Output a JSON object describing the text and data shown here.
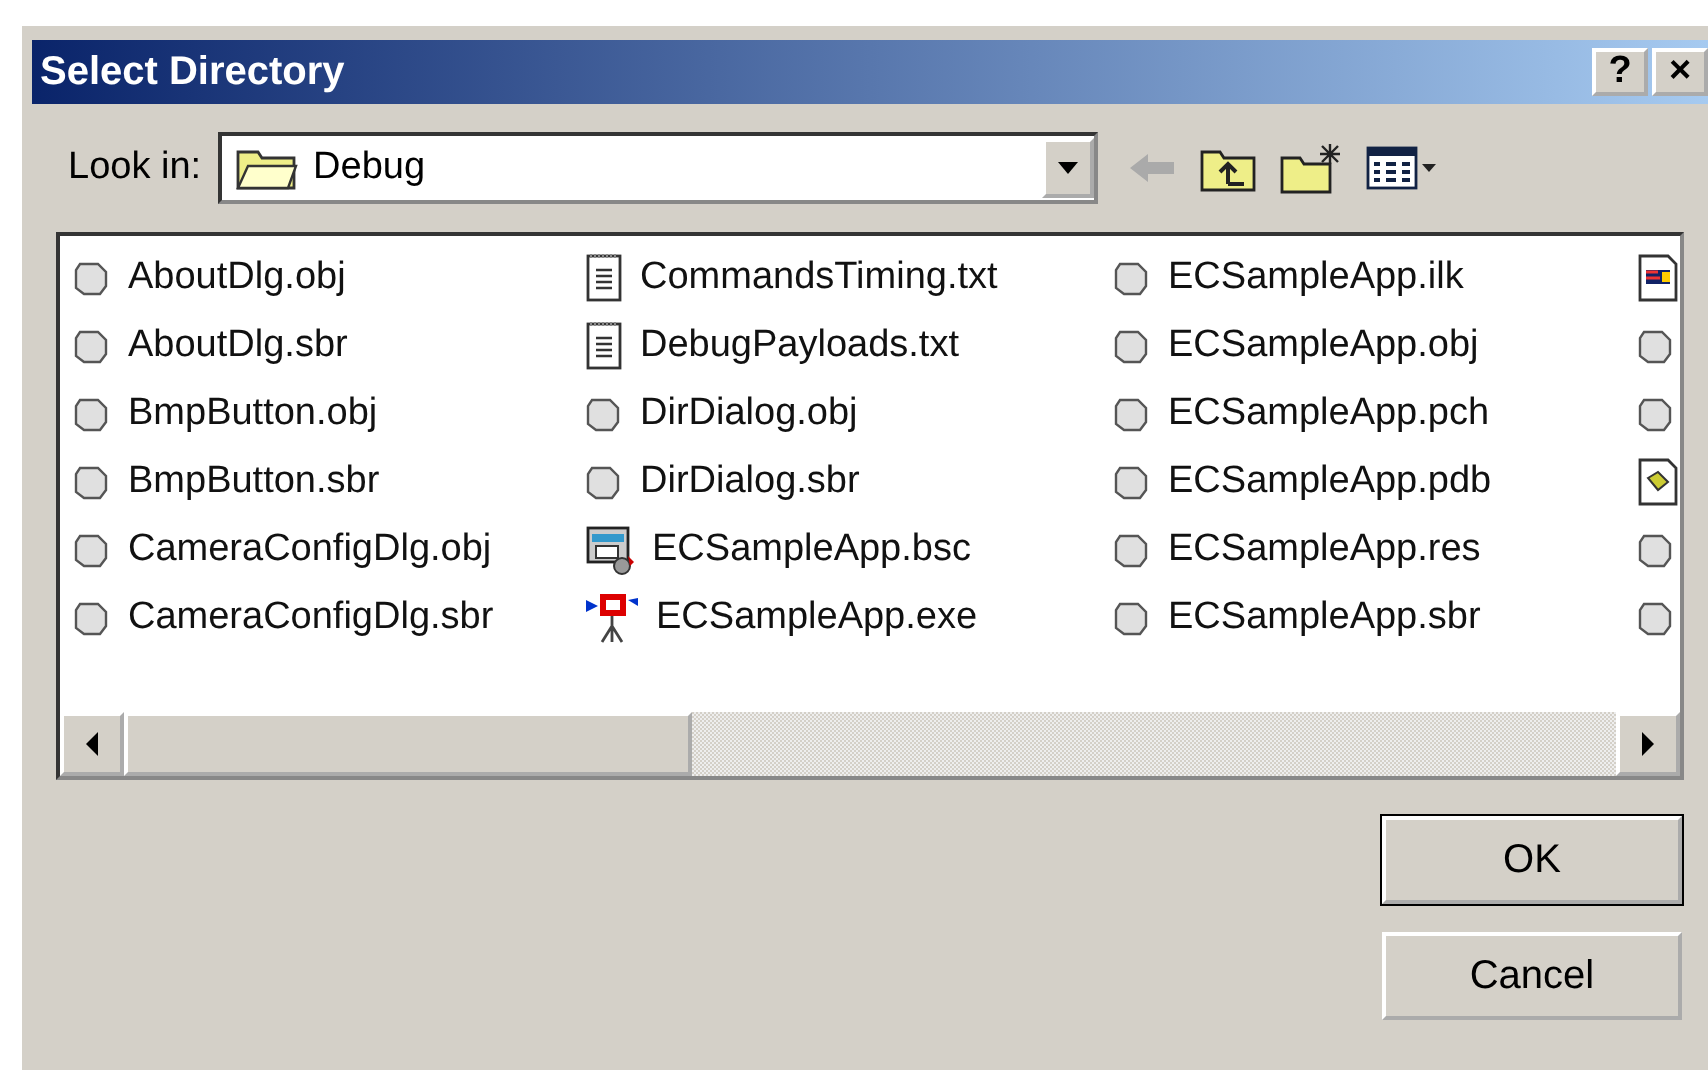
{
  "window": {
    "title": "Select Directory",
    "title_buttons": [
      "?",
      "×"
    ]
  },
  "look_in": {
    "label": "Look in:",
    "value": "Debug"
  },
  "toolbar": [
    {
      "kind": "back",
      "disabled": true
    },
    {
      "kind": "up",
      "disabled": false
    },
    {
      "kind": "new_folder",
      "disabled": false
    },
    {
      "kind": "view_menu",
      "disabled": false
    }
  ],
  "files": [
    {
      "name": "AboutDlg.obj",
      "kind": "object"
    },
    {
      "name": "AboutDlg.sbr",
      "kind": "object"
    },
    {
      "name": "BmpButton.obj",
      "kind": "object"
    },
    {
      "name": "BmpButton.sbr",
      "kind": "object"
    },
    {
      "name": "CameraConfigDlg.obj",
      "kind": "object"
    },
    {
      "name": "CameraConfigDlg.sbr",
      "kind": "object"
    },
    {
      "name": "CommandsTiming.txt",
      "kind": "text"
    },
    {
      "name": "DebugPayloads.txt",
      "kind": "text"
    },
    {
      "name": "DirDialog.obj",
      "kind": "object"
    },
    {
      "name": "DirDialog.sbr",
      "kind": "object"
    },
    {
      "name": "ECSampleApp.bsc",
      "kind": "browse"
    },
    {
      "name": "ECSampleApp.exe",
      "kind": "program"
    },
    {
      "name": "ECSampleApp.ilk",
      "kind": "object"
    },
    {
      "name": "ECSampleApp.obj",
      "kind": "object"
    },
    {
      "name": "ECSampleApp.pch",
      "kind": "object"
    },
    {
      "name": "ECSampleApp.pdb",
      "kind": "object"
    },
    {
      "name": "ECSampleApp.res",
      "kind": "object"
    },
    {
      "name": "ECSampleApp.sbr",
      "kind": "object"
    },
    {
      "kind": "linker"
    },
    {
      "kind": "object"
    },
    {
      "kind": "object"
    },
    {
      "kind": "database"
    },
    {
      "kind": "object"
    },
    {
      "kind": "object"
    }
  ],
  "buttons": [
    {
      "label": "OK",
      "default": true
    },
    {
      "label": "Cancel",
      "default": false
    }
  ]
}
